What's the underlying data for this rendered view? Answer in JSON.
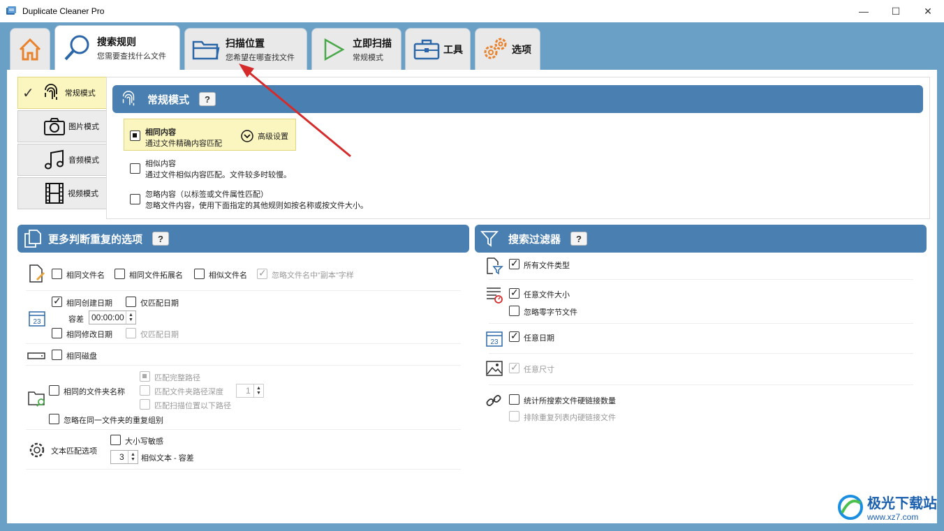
{
  "window": {
    "title": "Duplicate Cleaner Pro",
    "controls": [
      "—",
      "☐",
      "✕"
    ]
  },
  "tabs": [
    {
      "main": "",
      "sub": ""
    },
    {
      "main": "搜索规则",
      "sub": "您需要查找什么文件"
    },
    {
      "main": "扫描位置",
      "sub": "您希望在哪查找文件"
    },
    {
      "main": "立即扫描",
      "sub": "常规模式"
    },
    {
      "main": "工具",
      "sub": ""
    },
    {
      "main": "选项",
      "sub": ""
    }
  ],
  "modes": [
    "常规模式",
    "图片模式",
    "音频模式",
    "视频模式"
  ],
  "normal_mode": {
    "header": "常规模式",
    "help": "?",
    "opt_same": {
      "title": "相同内容",
      "desc": "通过文件精确内容匹配",
      "checked": true
    },
    "advanced": "高级设置",
    "opt_similar": {
      "title": "相似内容",
      "desc": "通过文件相似内容匹配。文件较多时较慢。"
    },
    "opt_ignore": {
      "title": "忽略内容（以标签或文件属性匹配）",
      "desc": "忽略文件内容，使用下面指定的其他规则如按名称或按文件大小。"
    }
  },
  "more": {
    "header": "更多判断重复的选项",
    "help": "?",
    "same_name": "相同文件名",
    "same_ext": "相同文件拓展名",
    "similar_name": "相似文件名",
    "ignore_copy": "忽略文件名中\"副本\"字样",
    "same_created": "相同创建日期",
    "date_only_1": "仅匹配日期",
    "tolerance_label": "容差",
    "tolerance_value": "00:00:00",
    "same_modified": "相同修改日期",
    "date_only_2": "仅匹配日期",
    "same_disk": "相同磁盘",
    "same_folder_name": "相同的文件夹名称",
    "full_path": "匹配完整路径",
    "path_depth": "匹配文件夹路径深度",
    "path_depth_value": "1",
    "below_scan": "匹配扫描位置以下路径",
    "ignore_same_folder": "忽略在同一文件夹的重复组别",
    "text_match": "文本匹配选项",
    "case_sensitive": "大小写敏感",
    "similar_text_value": "3",
    "similar_text": "相似文本 - 容差"
  },
  "filter": {
    "header": "搜索过滤器",
    "help": "?",
    "all_types": "所有文件类型",
    "any_size": "任意文件大小",
    "ignore_zero": "忽略零字节文件",
    "any_date": "任意日期",
    "any_dim": "任意尺寸",
    "count_hardlinks": "统计所搜索文件硬链接数量",
    "exclude_hardlinks": "排除重复列表内硬链接文件"
  },
  "watermark": {
    "cn": "极光下载站",
    "url": "www.xz7.com"
  },
  "colors": {
    "frame": "#6a9fc6",
    "header": "#4a7fb1",
    "highlight": "#fbf6bf",
    "arrow": "#d62b2b"
  }
}
